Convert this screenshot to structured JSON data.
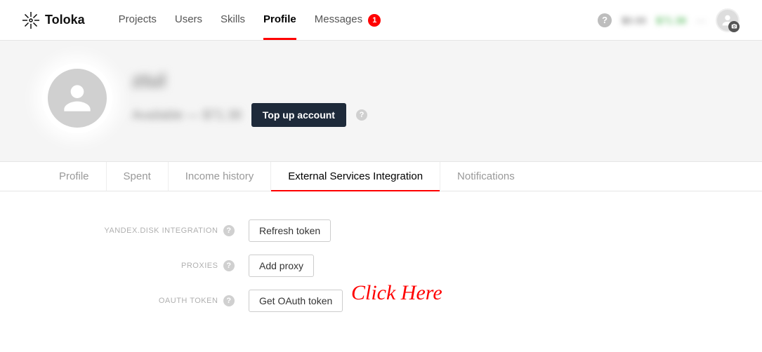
{
  "brand": "Toloka",
  "nav": {
    "projects": "Projects",
    "users": "Users",
    "skills": "Skills",
    "profile": "Profile",
    "messages": "Messages",
    "messages_badge": "1"
  },
  "nav_right": {
    "blurred1": "$0.00",
    "blurred2": "$71.38",
    "blurred3": "···"
  },
  "profile": {
    "name_blurred": "ztul",
    "sub_blurred": "Available — $71.38",
    "topup": "Top up account"
  },
  "subtabs": {
    "profile": "Profile",
    "spent": "Spent",
    "income": "Income history",
    "external": "External Services Integration",
    "notifications": "Notifications"
  },
  "settings": {
    "yandex_label": "YANDEX.DISK INTEGRATION",
    "yandex_btn": "Refresh token",
    "proxies_label": "PROXIES",
    "proxies_btn": "Add proxy",
    "oauth_label": "OAUTH TOKEN",
    "oauth_btn": "Get OAuth token"
  },
  "annotation": "Click Here"
}
